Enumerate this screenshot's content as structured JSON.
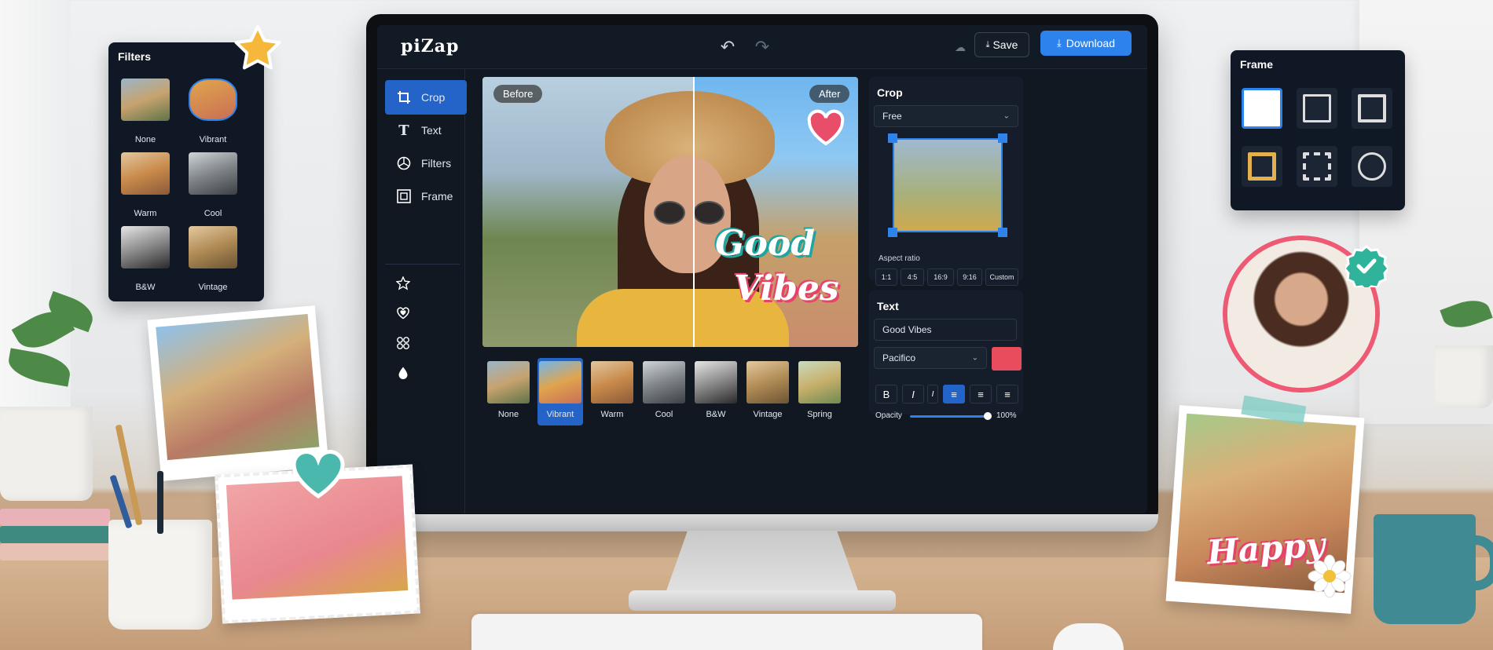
{
  "app": {
    "logo": "piZap",
    "save_label": "Save",
    "download_label": "Download"
  },
  "sidebar": {
    "items": [
      {
        "label": "Crop",
        "icon": "crop-icon"
      },
      {
        "label": "Text",
        "icon": "text-icon"
      },
      {
        "label": "Filters",
        "icon": "filters-icon"
      },
      {
        "label": "Frame",
        "icon": "frame-icon"
      }
    ],
    "extra_icons": [
      "star-icon",
      "heart-sticker-icon",
      "grid-icon",
      "drop-icon"
    ]
  },
  "canvas": {
    "before_label": "Before",
    "after_label": "After",
    "overlay_line1": "Good",
    "overlay_line2": "Vibes"
  },
  "filmstrip": [
    {
      "label": "None"
    },
    {
      "label": "Vibrant",
      "selected": true
    },
    {
      "label": "Warm"
    },
    {
      "label": "Cool"
    },
    {
      "label": "B&W"
    },
    {
      "label": "Vintage"
    },
    {
      "label": "Spring"
    }
  ],
  "crop_panel": {
    "title": "Crop",
    "mode": "Free",
    "aspect_label": "Aspect ratio",
    "ratios": [
      "1:1",
      "4:5",
      "16:9",
      "9:16",
      "Custom"
    ]
  },
  "text_panel": {
    "title": "Text",
    "value": "Good Vibes",
    "font": "Pacifico",
    "color": "#e84d5d",
    "format_buttons": [
      "B",
      "I",
      "I",
      "≡",
      "≡",
      "≡"
    ],
    "opacity_label": "Opacity",
    "opacity_value": "100%",
    "opacity_level": 1.0
  },
  "filters_card": {
    "title": "Filters",
    "items": [
      "None",
      "Vibrant",
      "Warm",
      "Cool",
      "B&W",
      "Vintage"
    ]
  },
  "frame_card": {
    "title": "Frame"
  },
  "sticker_text": "Happy",
  "colors": {
    "accent": "#2d82ec",
    "active": "#2463c8",
    "panel": "#111822"
  }
}
